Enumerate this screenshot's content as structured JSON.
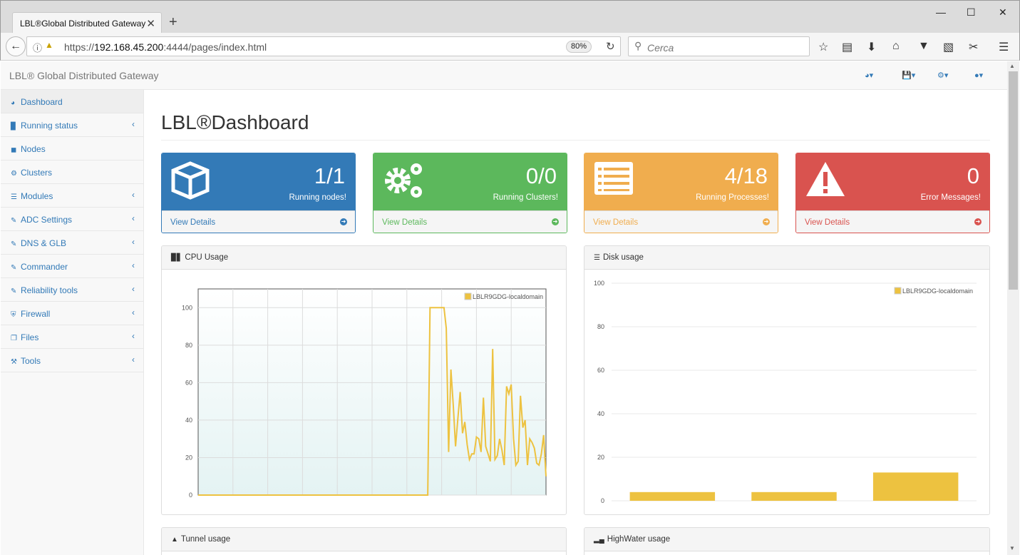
{
  "browser": {
    "tab_title": "LBL®Global Distributed Gateway",
    "tab_close": "✕",
    "new_tab": "+",
    "url_prefix": "https://",
    "url_host": "192.168.45.200",
    "url_rest": ":4444/pages/index.html",
    "zoom": "80%",
    "search_placeholder": "Cerca"
  },
  "app": {
    "brand": "LBL® Global Distributed Gateway",
    "page_title": "LBL®Dashboard"
  },
  "sidebar": {
    "items": [
      {
        "label": "Dashboard",
        "icon": "dashboard-icon"
      },
      {
        "label": "Running status",
        "icon": "bar-chart-icon"
      },
      {
        "label": "Nodes",
        "icon": "cube-icon"
      },
      {
        "label": "Clusters",
        "icon": "cogs-icon"
      },
      {
        "label": "Modules",
        "icon": "list-icon"
      },
      {
        "label": "ADC Settings",
        "icon": "edit-icon"
      },
      {
        "label": "DNS & GLB",
        "icon": "edit-icon"
      },
      {
        "label": "Commander",
        "icon": "edit-icon"
      },
      {
        "label": "Reliability tools",
        "icon": "edit-icon"
      },
      {
        "label": "Firewall",
        "icon": "shield-icon"
      },
      {
        "label": "Files",
        "icon": "files-icon"
      },
      {
        "label": "Tools",
        "icon": "wrench-icon"
      }
    ]
  },
  "stats": [
    {
      "value": "1/1",
      "label": "Running nodes!",
      "link": "View Details",
      "color": "#337ab7",
      "icon": "cube-icon"
    },
    {
      "value": "0/0",
      "label": "Running Clusters!",
      "link": "View Details",
      "color": "#5cb85c",
      "icon": "cogs-icon"
    },
    {
      "value": "4/18",
      "label": "Running Processes!",
      "link": "View Details",
      "color": "#f0ad4e",
      "icon": "list-alt-icon"
    },
    {
      "value": "0",
      "label": "Error Messages!",
      "link": "View Details",
      "color": "#d9534f",
      "icon": "warning-icon"
    }
  ],
  "panels": {
    "cpu": "CPU Usage",
    "disk": "Disk usage",
    "tunnel": "Tunnel usage",
    "highwater": "HighWater usage"
  },
  "chart_data": [
    {
      "type": "line",
      "title": "CPU Usage",
      "series": [
        {
          "name": "LBLR9GDG-localdomain",
          "color": "#edc240",
          "values": [
            0,
            0,
            0,
            0,
            0,
            0,
            0,
            0,
            0,
            0,
            0,
            0,
            0,
            0,
            0,
            0,
            0,
            0,
            0,
            0,
            0,
            0,
            0,
            0,
            0,
            0,
            0,
            0,
            0,
            0,
            0,
            0,
            0,
            0,
            0,
            0,
            0,
            0,
            0,
            0,
            0,
            0,
            0,
            0,
            0,
            0,
            0,
            0,
            0,
            0,
            0,
            0,
            0,
            0,
            0,
            0,
            0,
            0,
            0,
            0,
            0,
            0,
            0,
            0,
            0,
            0,
            0,
            0,
            0,
            0,
            0,
            0,
            0,
            0,
            0,
            0,
            0,
            0,
            0,
            0,
            0,
            0,
            0,
            0,
            0,
            0,
            0,
            0,
            0,
            0,
            0,
            0,
            0,
            0,
            0,
            0,
            0,
            0,
            0,
            0,
            100,
            100,
            100,
            100,
            100,
            100,
            100,
            89,
            23,
            67,
            48,
            26,
            41,
            55,
            33,
            39,
            27,
            19,
            22,
            22,
            31,
            30,
            23,
            52,
            26,
            22,
            18,
            78,
            19,
            21,
            30,
            24,
            16,
            58,
            54,
            59,
            30,
            16,
            18,
            53,
            36,
            40,
            16,
            30,
            28,
            25,
            17,
            16,
            22,
            32,
            10
          ]
        }
      ],
      "ylim": [
        0,
        110
      ],
      "yticks": [
        0,
        20,
        40,
        60,
        80,
        100
      ],
      "grid": true,
      "legend": "top-right"
    },
    {
      "type": "bar",
      "title": "Disk usage",
      "series": [
        {
          "name": "LBLR9GDG-localdomain",
          "color": "#edc240",
          "values": [
            4,
            4,
            13
          ]
        }
      ],
      "ylim": [
        0,
        100
      ],
      "yticks": [
        0,
        20,
        40,
        60,
        80,
        100
      ],
      "grid": true,
      "legend": "top-right"
    }
  ]
}
